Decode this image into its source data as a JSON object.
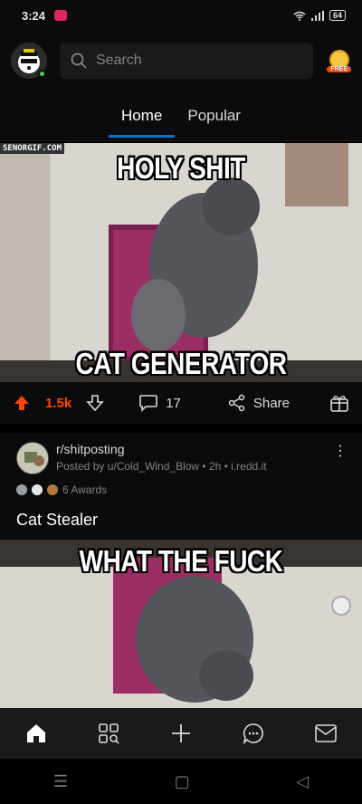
{
  "status": {
    "time": "3:24",
    "battery": "64"
  },
  "header": {
    "search_placeholder": "Search",
    "coin_label": "FREE"
  },
  "tabs": [
    {
      "label": "Home"
    },
    {
      "label": "Popular"
    }
  ],
  "post1": {
    "watermark": "SENORGIF.COM",
    "top_text": "HOLY SHIT",
    "bottom_text": "CAT GENERATOR",
    "votes": "1.5k",
    "comments": "17",
    "share_label": "Share"
  },
  "post2": {
    "subreddit": "r/shitposting",
    "meta": "Posted by u/Cold_Wind_Blow • 2h • i.redd.it",
    "awards": "6 Awards",
    "title": "Cat Stealer",
    "image_text": "WHAT THE FUCK"
  },
  "icons": {
    "search": "search-icon",
    "upvote": "upvote-icon",
    "downvote": "downvote-icon",
    "comment": "comment-icon",
    "share": "share-icon",
    "gift": "gift-icon",
    "home": "home-icon",
    "discover": "discover-icon",
    "create": "plus-icon",
    "chat": "chat-icon",
    "inbox": "mail-icon"
  },
  "colors": {
    "accent": "#0079d3",
    "upvote": "#ff4500",
    "background": "#0b0b0b"
  }
}
